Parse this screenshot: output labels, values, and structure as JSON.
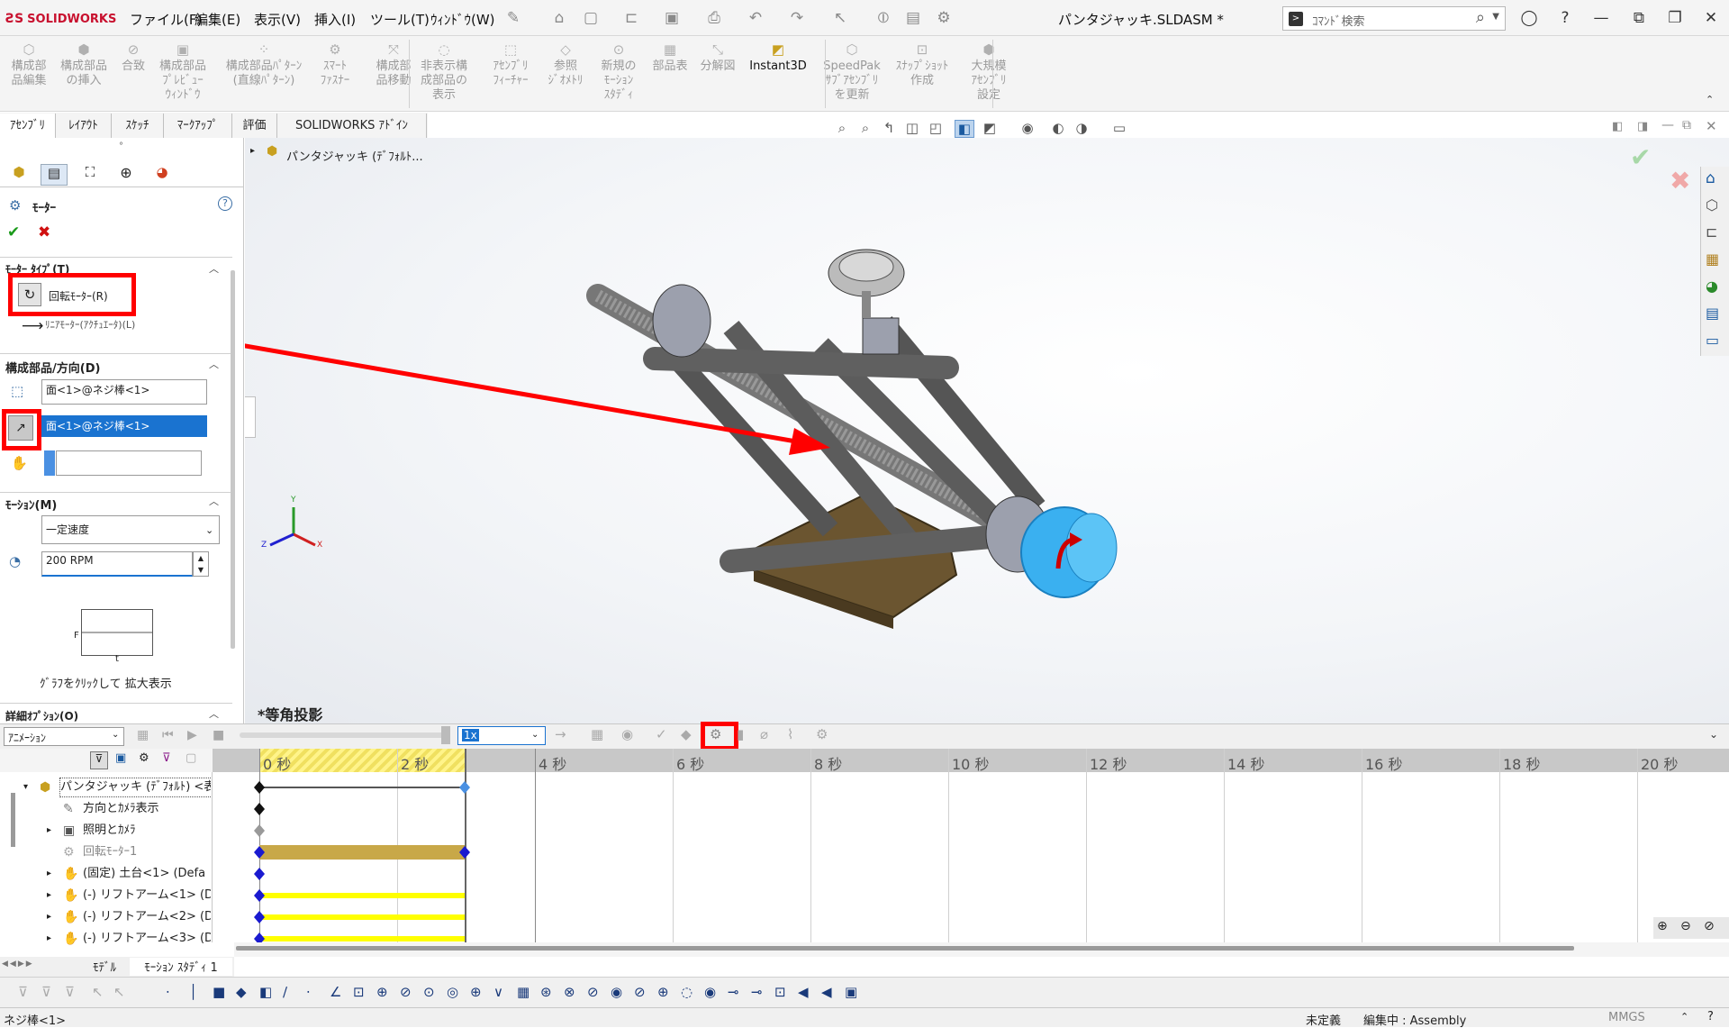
{
  "app": {
    "brand": "SOLIDWORKS",
    "doc_title": "パンタジャッキ.SLDASM *"
  },
  "menu": [
    "ファイル(F)",
    "編集(E)",
    "表示(V)",
    "挿入(I)",
    "ツール(T)",
    "ｳｨﾝﾄﾞｳ(W)"
  ],
  "search": {
    "placeholder": "ｺﾏﾝﾄﾞ検索"
  },
  "command_manager": {
    "buttons": [
      "構成部\n品編集",
      "構成部品\nの挿入",
      "合致",
      "構成部品\nﾌﾟﾚﾋﾞｭｰ\nｳｨﾝﾄﾞｳ",
      "構成部品ﾊﾟﾀｰﾝ\n(直線ﾊﾟﾀｰﾝ)",
      "ｽﾏｰﾄ\nﾌｧｽﾅｰ",
      "構成部\n品移動",
      "非表示構\n成部品の\n表示",
      "ｱｾﾝﾌﾞﾘ\nﾌｨｰﾁｬｰ",
      "参照\nｼﾞｵﾒﾄﾘ",
      "新規の\nﾓｰｼｮﾝ\nｽﾀﾃﾞｨ",
      "部品表",
      "分解図",
      "Instant3D",
      "SpeedPak\nｻﾌﾞｱｾﾝﾌﾞﾘ\nを更新",
      "ｽﾅｯﾌﾟｼｮｯﾄ\n作成",
      "大規模\nｱｾﾝﾌﾞﾘ\n設定"
    ]
  },
  "tabs": [
    "ｱｾﾝﾌﾞﾘ",
    "ﾚｲｱｳﾄ",
    "ｽｹｯﾁ",
    "ﾏｰｸｱｯﾌﾟ",
    "評価",
    "SOLIDWORKS ｱﾄﾞｲﾝ"
  ],
  "property_manager": {
    "title": "ﾓｰﾀｰ",
    "motor_type": {
      "header": "ﾓｰﾀｰ ﾀｲﾌﾟ(T)",
      "rotary": "回転ﾓｰﾀｰ(R)",
      "linear": "ﾘﾆｱﾓｰﾀｰ(ｱｸﾁｭｴｰﾀ)(L)"
    },
    "component_direction": {
      "header": "構成部品/方向(D)",
      "face1": "面<1>@ネジ棒<1>",
      "face2": "面<1>@ネジ棒<1>",
      "face3": ""
    },
    "motion": {
      "header": "ﾓｰｼｮﾝ(M)",
      "type": "一定速度",
      "speed": "200 RPM",
      "graph_f": "F",
      "graph_t": "t",
      "graph_hint": "ｸﾞﾗﾌをｸﾘｯｸして 拡大表示"
    },
    "advanced": {
      "header": "詳細ｵﾌﾟｼｮﾝ(O)"
    }
  },
  "graphics": {
    "tree_root": "パンタジャッキ (ﾃﾞﾌｫﾙﾄ...",
    "view_label": "*等角投影",
    "triad": {
      "x": "X",
      "y": "Y",
      "z": "Z"
    }
  },
  "motion_manager": {
    "study_type": "ｱﾆﾒｰｼｮﾝ",
    "playback_speed": "1x",
    "time_ticks": [
      "0 秒",
      "2 秒",
      "4 秒",
      "6 秒",
      "8 秒",
      "10 秒",
      "12 秒",
      "14 秒",
      "16 秒",
      "18 秒",
      "20 秒"
    ],
    "tree": [
      {
        "label": "パンタジャッキ (ﾃﾞﾌｫﾙﾄ) <表",
        "level": 0
      },
      {
        "label": "方向とｶﾒﾗ表示",
        "level": 1
      },
      {
        "label": "照明とｶﾒﾗ",
        "level": 1
      },
      {
        "label": "回転ﾓｰﾀｰ1",
        "level": 1
      },
      {
        "label": "(固定) 土台<1> (Defa",
        "level": 1
      },
      {
        "label": "(-) リフトアーム<1> (De",
        "level": 1
      },
      {
        "label": "(-) リフトアーム<2> (De",
        "level": 1
      },
      {
        "label": "(-) リフトアーム<3> (De",
        "level": 1
      }
    ]
  },
  "bottom_tabs": [
    "ﾓﾃﾞﾙ",
    "ﾓｰｼｮﾝ ｽﾀﾃﾞｨ 1"
  ],
  "status": {
    "selection": "ネジ棒<1>",
    "state": "未定義",
    "editing": "編集中 : Assembly",
    "units": "MMGS"
  },
  "colors": {
    "highlight": "#ff0000",
    "motor_cyan": "#3ab0f0",
    "timeline_bar": "#c8a848",
    "yellow_bar": "#ffff00"
  }
}
